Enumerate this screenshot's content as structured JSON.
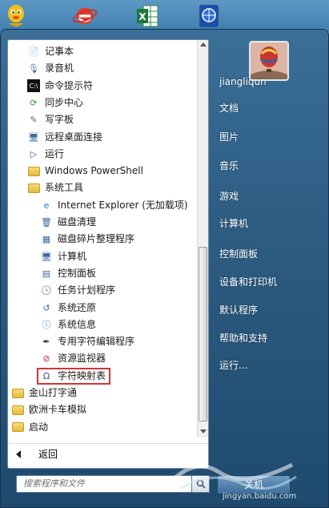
{
  "taskbar": {
    "icons": [
      {
        "name": "qq-icon"
      },
      {
        "name": "ie-browser-icon"
      },
      {
        "name": "excel-icon"
      },
      {
        "name": "basketball-app-icon"
      }
    ]
  },
  "programs": [
    {
      "label": "记事本",
      "icon": "notepad-icon",
      "kind": "app"
    },
    {
      "label": "录音机",
      "icon": "microphone-icon",
      "kind": "app"
    },
    {
      "label": "命令提示符",
      "icon": "cmd-icon",
      "kind": "app"
    },
    {
      "label": "同步中心",
      "icon": "sync-icon",
      "kind": "app"
    },
    {
      "label": "写字板",
      "icon": "wordpad-icon",
      "kind": "app"
    },
    {
      "label": "远程桌面连接",
      "icon": "remote-desktop-icon",
      "kind": "app"
    },
    {
      "label": "运行",
      "icon": "run-icon",
      "kind": "app"
    },
    {
      "label": "Windows PowerShell",
      "icon": "folder-icon",
      "kind": "folder"
    },
    {
      "label": "系统工具",
      "icon": "folder-icon",
      "kind": "folder"
    },
    {
      "label": "Internet Explorer (无加载项)",
      "icon": "ie-icon",
      "kind": "sub"
    },
    {
      "label": "磁盘清理",
      "icon": "disk-cleanup-icon",
      "kind": "sub"
    },
    {
      "label": "磁盘碎片整理程序",
      "icon": "defrag-icon",
      "kind": "sub"
    },
    {
      "label": "计算机",
      "icon": "computer-icon",
      "kind": "sub"
    },
    {
      "label": "控制面板",
      "icon": "control-panel-icon",
      "kind": "sub"
    },
    {
      "label": "任务计划程序",
      "icon": "clock-icon",
      "kind": "sub"
    },
    {
      "label": "系统还原",
      "icon": "system-restore-icon",
      "kind": "sub"
    },
    {
      "label": "系统信息",
      "icon": "system-info-icon",
      "kind": "sub"
    },
    {
      "label": "专用字符编辑程序",
      "icon": "pen-icon",
      "kind": "sub"
    },
    {
      "label": "资源监视器",
      "icon": "monitor-icon",
      "kind": "sub"
    },
    {
      "label": "字符映射表",
      "icon": "char-map-icon",
      "kind": "sub",
      "highlighted": true
    },
    {
      "label": "金山打字通",
      "icon": "folder-icon",
      "kind": "topfolder"
    },
    {
      "label": "欧洲卡车模拟",
      "icon": "folder-icon",
      "kind": "topfolder"
    },
    {
      "label": "启动",
      "icon": "folder-icon",
      "kind": "topfolder"
    }
  ],
  "back": {
    "label": "返回"
  },
  "search": {
    "placeholder": "搜索程序和文件"
  },
  "right_menu": [
    {
      "label": "jiangliqun",
      "name": "user-name"
    },
    {
      "label": "文档",
      "name": "documents"
    },
    {
      "label": "图片",
      "name": "pictures"
    },
    {
      "label": "音乐",
      "name": "music"
    },
    {
      "label": "游戏",
      "name": "games"
    },
    {
      "label": "计算机",
      "name": "computer"
    },
    {
      "label": "控制面板",
      "name": "control-panel"
    },
    {
      "label": "设备和打印机",
      "name": "devices-printers"
    },
    {
      "label": "默认程序",
      "name": "default-programs"
    },
    {
      "label": "帮助和支持",
      "name": "help-support"
    },
    {
      "label": "运行...",
      "name": "run"
    }
  ],
  "shutdown": {
    "label": "关机"
  },
  "watermark": {
    "text": "jingyan.baidu.com"
  },
  "colors": {
    "highlight_border": "#d23434",
    "menu_bg": "#2e5d83"
  }
}
